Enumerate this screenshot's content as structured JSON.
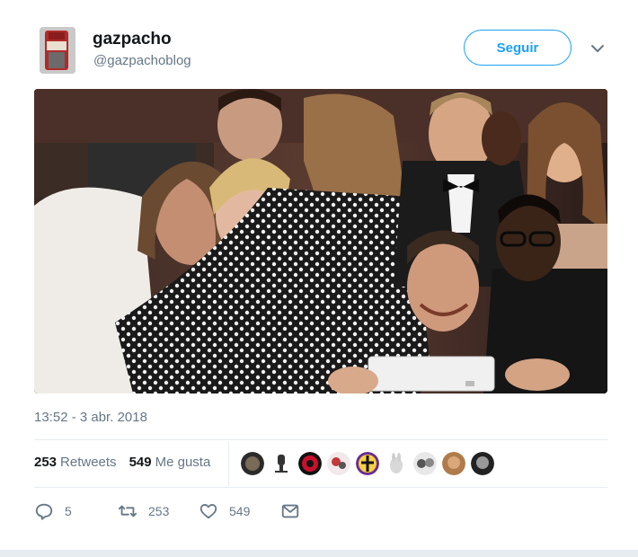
{
  "user": {
    "name": "gazpacho",
    "handle": "@gazpachoblog"
  },
  "follow_button": {
    "label": "Seguir"
  },
  "timestamp": "13:52 - 3 abr. 2018",
  "stats": {
    "retweets_count": "253",
    "retweets_label": "Retweets",
    "likes_count": "549",
    "likes_label": "Me gusta"
  },
  "actions": {
    "reply_count": "5",
    "retweet_count": "253",
    "like_count": "549"
  },
  "colors": {
    "accent": "#1da1f2",
    "muted": "#657786",
    "divider": "#e6ecf0"
  }
}
